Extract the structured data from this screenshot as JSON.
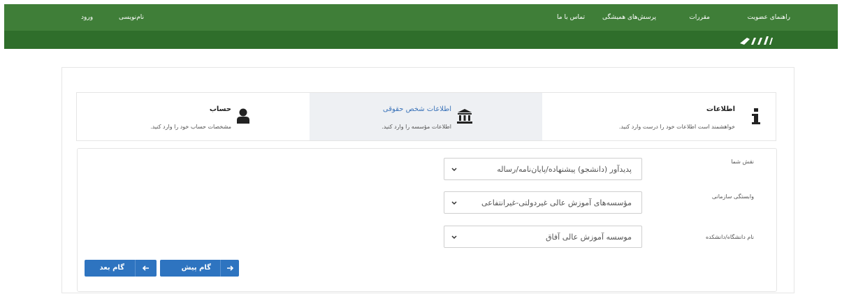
{
  "nav": {
    "right_links": [
      "راهنمای عضویت",
      "مقررات",
      "پرسش‌های همیشگی",
      "تماس با ما"
    ],
    "left_links": [
      "نام‌نویسی",
      "ورود"
    ]
  },
  "steps": [
    {
      "title": "اطلاعات",
      "desc": "خواهشمند است اطلاعات خود را درست وارد کنید.",
      "icon": "info-icon",
      "active": false
    },
    {
      "title": "اطلاعات شخص حقوقی",
      "desc": "اطلاعات مؤسسه را وارد کنید.",
      "icon": "institution-icon",
      "active": true
    },
    {
      "title": "حساب",
      "desc": "مشخصات حساب خود را وارد کنید.",
      "icon": "user-icon",
      "active": false
    }
  ],
  "form": {
    "role": {
      "label": "نقش شما",
      "value": "پدیدآور (دانشجو) پیشنهاده/پایان‌نامه/رساله"
    },
    "affiliation": {
      "label": "وابستگی سازمانی",
      "value": "مؤسسه‌های آموزش عالی غیردولتی-غیرانتفاعی"
    },
    "university": {
      "label": "نام دانشگاه/دانشکده",
      "value": "موسسه آموزش عالی آفاق"
    }
  },
  "buttons": {
    "prev": "گام پیش",
    "next": "گام بعد"
  },
  "colors": {
    "header_green": "#3f7e38",
    "primary_blue": "#2e74c0",
    "active_step_bg": "#eef0f3"
  }
}
